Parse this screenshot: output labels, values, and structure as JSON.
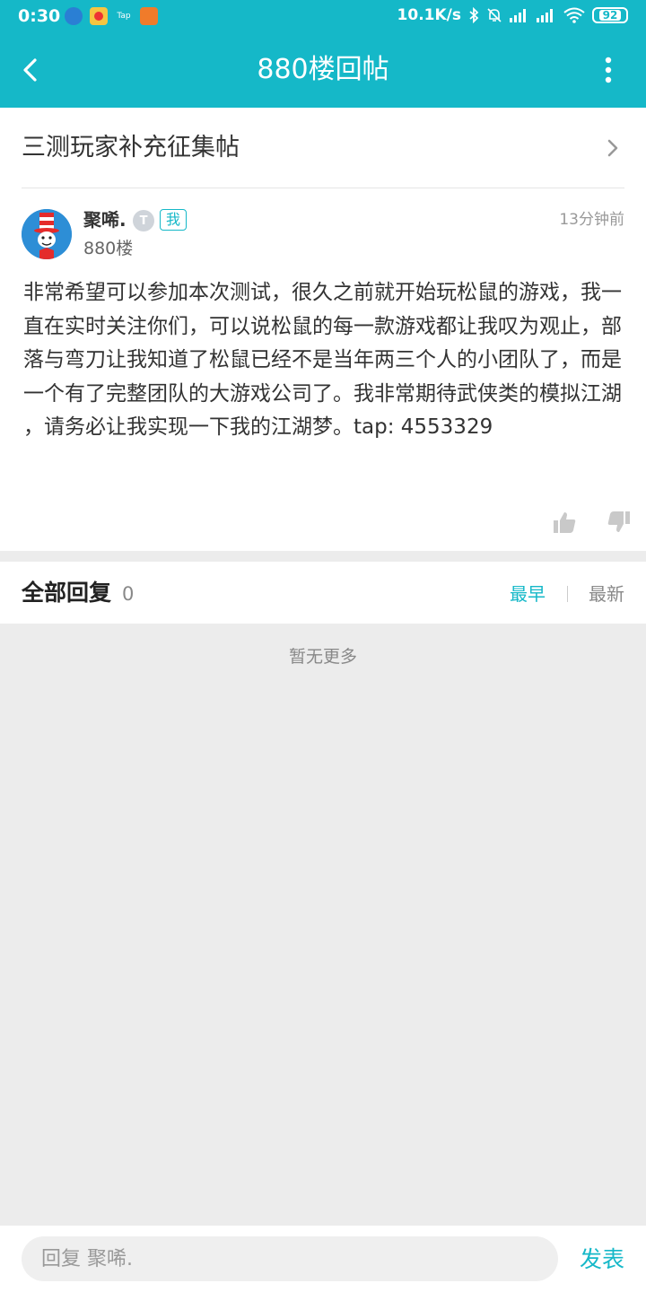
{
  "status_bar": {
    "time": "0:30",
    "speed": "10.1K/s",
    "battery": "92",
    "app_icons": [
      "app-icon-blue",
      "app-icon-weibo",
      "app-icon-tap",
      "app-icon-orange"
    ]
  },
  "header": {
    "title": "880楼回帖",
    "back_icon": "back-arrow-icon",
    "more_icon": "more-vertical-icon",
    "color": "#15b8c8"
  },
  "topic": {
    "title": "三测玩家补充征集帖"
  },
  "post": {
    "author": "聚唏.",
    "level_badge": "T",
    "me_badge": "我",
    "time": "13分钟前",
    "floor": "880楼",
    "body": " 非常希望可以参加本次测试，很久之前就开始玩松鼠的游戏，我一直在实时关注你们，可以说松鼠的每一款游戏都让我叹为观止，部落与弯刀让我知道了松鼠已经不是当年两三个人的小团队了，而是一个有了完整团队的大游戏公司了。我非常期待武侠类的模拟江湖 ，请务必让我实现一下我的江湖梦。tap: 4553329"
  },
  "replies": {
    "title": "全部回复",
    "count": "0",
    "sort_earliest": "最早",
    "sort_latest": "最新",
    "active_sort": "earliest",
    "empty_text": "暂无更多"
  },
  "composer": {
    "placeholder": "回复 聚唏.",
    "value": "",
    "submit_label": "发表"
  }
}
